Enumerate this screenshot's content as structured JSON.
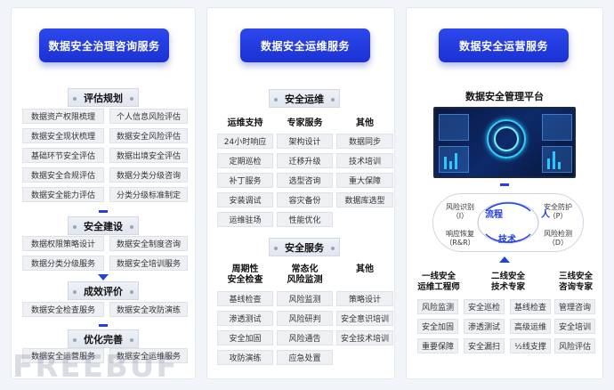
{
  "col1": {
    "title": "数据安全治理咨询服务",
    "phases": [
      {
        "name": "评估规划",
        "items": [
          "数据资产权限梳理",
          "个人信息风险评估",
          "数据安全现状梳理",
          "数据安全风险评估",
          "基础环节安全评估",
          "数据出境安全评估",
          "数据安全合规评估",
          "数据分类分级咨询",
          "数据安全能力评估",
          "分类分级标准制定"
        ]
      },
      {
        "name": "安全建设",
        "items": [
          "数据权限策略设计",
          "数据安全制度咨询",
          "数据分类分级服务",
          "数据安全培训服务"
        ]
      },
      {
        "name": "成效评价",
        "items": [
          "数据安全检查服务",
          "数据安全攻防演练"
        ]
      },
      {
        "name": "优化完善",
        "items": [
          "数据安全运营服务",
          "数据安全运维服务"
        ]
      }
    ]
  },
  "col2": {
    "title": "数据安全运维服务",
    "ops": {
      "name": "安全运维",
      "groups": [
        {
          "name": "运维支持",
          "items": [
            "24小时响应",
            "定期巡检",
            "补丁服务",
            "安装调试",
            "运维驻场"
          ]
        },
        {
          "name": "专家服务",
          "items": [
            "架构设计",
            "迁移升级",
            "选型咨询",
            "容灾备份",
            "性能优化"
          ]
        },
        {
          "name": "其他",
          "items": [
            "数据同步",
            "技术培训",
            "重大保障",
            "数据库选型"
          ]
        }
      ]
    },
    "svc": {
      "name": "安全服务",
      "groups": [
        {
          "name": "周期性\n安全检查",
          "items": [
            "基线检查",
            "渗透测试",
            "安全加固",
            "攻防演练"
          ]
        },
        {
          "name": "常态化\n风险监测",
          "items": [
            "风险监测",
            "风险研判",
            "风险通告",
            "应急处置"
          ]
        },
        {
          "name": "其他",
          "items": [
            "策略设计",
            "安全意识培训",
            "安全技术培训"
          ]
        }
      ]
    }
  },
  "col3": {
    "title": "数据安全运营服务",
    "platform": "数据安全管理平台",
    "cycle": {
      "left_top": "风险识别\n（I）",
      "left_bottom": "响应恢复\n（R&R）",
      "right_top": "安全防护\n（P）",
      "right_bottom": "风险检测\n（D）",
      "flow": "流程",
      "person": "人",
      "tech": "技术"
    },
    "tiers": [
      {
        "name": "一线安全\n运维工程师",
        "items": [
          "风险监测",
          "安全加固",
          "重要保障"
        ]
      },
      {
        "name": "二线安全\n技术专家",
        "items": [
          "安全巡检",
          "渗透测试",
          "安全漏扫"
        ]
      },
      {
        "name": "",
        "items": [
          "基线检查",
          "高级运维",
          "½线支撑"
        ]
      },
      {
        "name": "三线安全\n咨询专家",
        "items": [
          "管理咨询",
          "安全培训",
          "风险评估"
        ]
      }
    ]
  },
  "watermark": "FREEBUF",
  "colors": {
    "accent": "#2440e0",
    "cell_bg": "#eef0f4"
  }
}
